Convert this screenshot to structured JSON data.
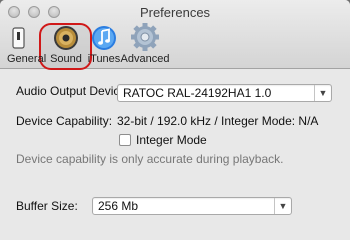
{
  "window": {
    "title": "Preferences"
  },
  "toolbar": {
    "items": [
      {
        "label": "General",
        "icon": "switch-icon"
      },
      {
        "label": "Sound",
        "icon": "speaker-icon",
        "selected": true
      },
      {
        "label": "iTunes",
        "icon": "itunes-icon"
      },
      {
        "label": "Advanced",
        "icon": "gear-icon"
      }
    ]
  },
  "audio_output": {
    "label": "Audio Output Device:",
    "value": "RATOC RAL-24192HA1 1.0"
  },
  "capability": {
    "label": "Device Capability:",
    "value": "32-bit / 192.0 kHz / Integer Mode: N/A"
  },
  "integer_mode": {
    "label": "Integer Mode",
    "checked": false
  },
  "capability_note": "Device capability is only accurate during playback.",
  "buffer": {
    "label": "Buffer Size:",
    "value": "256 Mb"
  },
  "colors": {
    "highlight": "#d01818",
    "window_bg": "#e8e8e8",
    "note_text": "#777777"
  }
}
